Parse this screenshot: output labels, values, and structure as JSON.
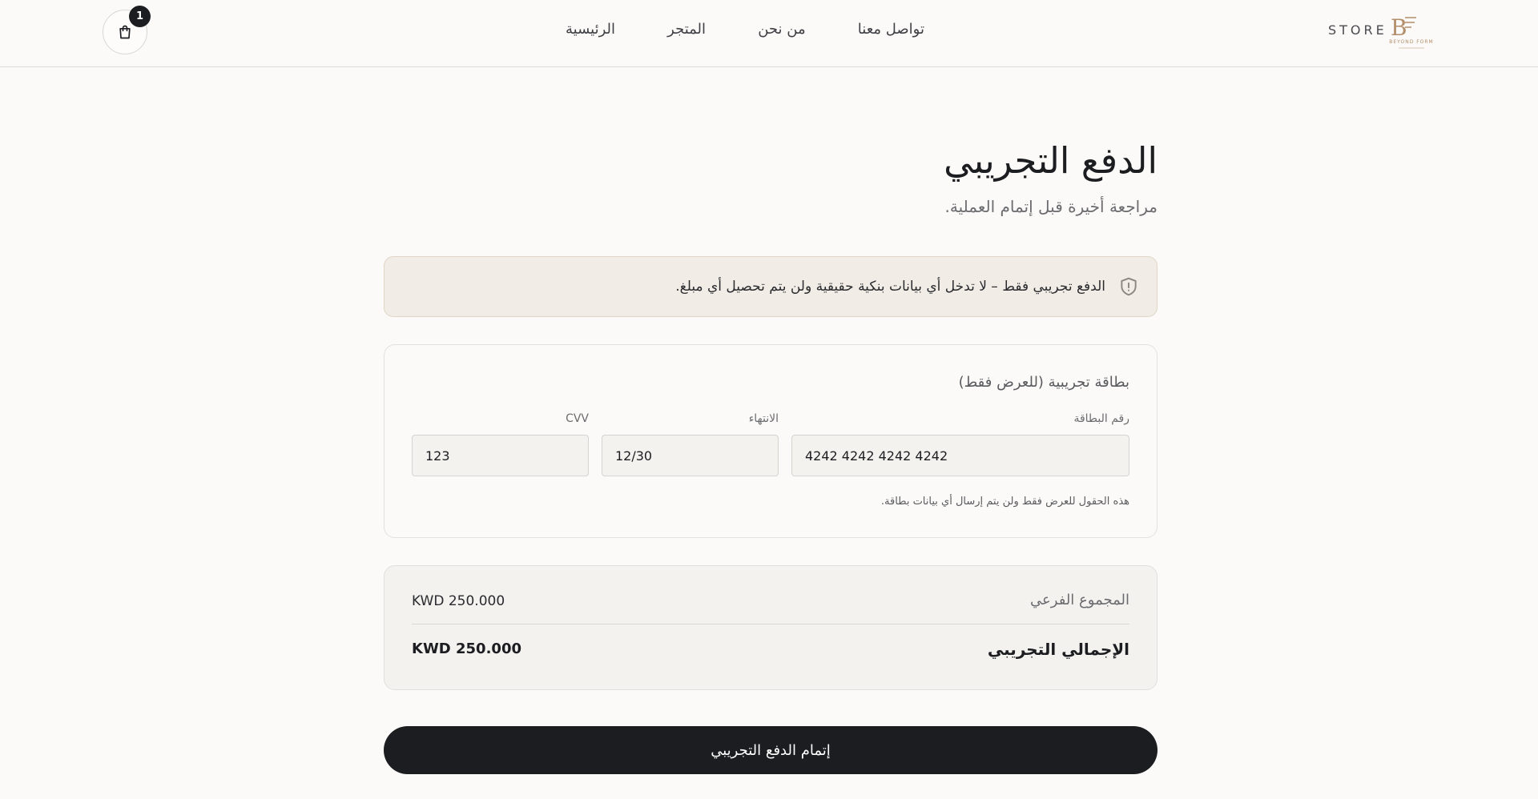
{
  "header": {
    "cart_count": "1",
    "nav": [
      {
        "label": "الرئيسية"
      },
      {
        "label": "المتجر"
      },
      {
        "label": "من نحن"
      },
      {
        "label": "تواصل معنا"
      }
    ],
    "brand_text": "STORE",
    "logo_text": "BEYOND FORM"
  },
  "page": {
    "title": "الدفع التجريبي",
    "subtitle": "مراجعة أخيرة قبل إتمام العملية."
  },
  "notice": {
    "icon": "shield-alert-icon",
    "text": "الدفع تجريبي فقط – لا تدخل أي بيانات بنكية حقيقية ولن يتم تحصيل أي مبلغ."
  },
  "card_form": {
    "heading": "بطاقة تجريبية (للعرض فقط)",
    "card_number": {
      "label": "رقم البطاقة",
      "value": "4242 4242 4242 4242"
    },
    "expiry": {
      "label": "الانتهاء",
      "value": "12/30"
    },
    "cvv": {
      "label": "CVV",
      "value": "123"
    },
    "note": "هذه الحقول للعرض فقط ولن يتم إرسال أي بيانات بطاقة."
  },
  "totals": {
    "subtotal_label": "المجموع الفرعي",
    "subtotal_value": "KWD 250.000",
    "total_label": "الإجمالي التجريبي",
    "total_value": "KWD 250.000"
  },
  "actions": {
    "pay_label": "إتمام الدفع التجريبي"
  },
  "colors": {
    "background": "#fbfaf8",
    "primary": "#1c1d20",
    "notice_bg": "#f1ede6",
    "logo_accent": "#b38e6a"
  }
}
